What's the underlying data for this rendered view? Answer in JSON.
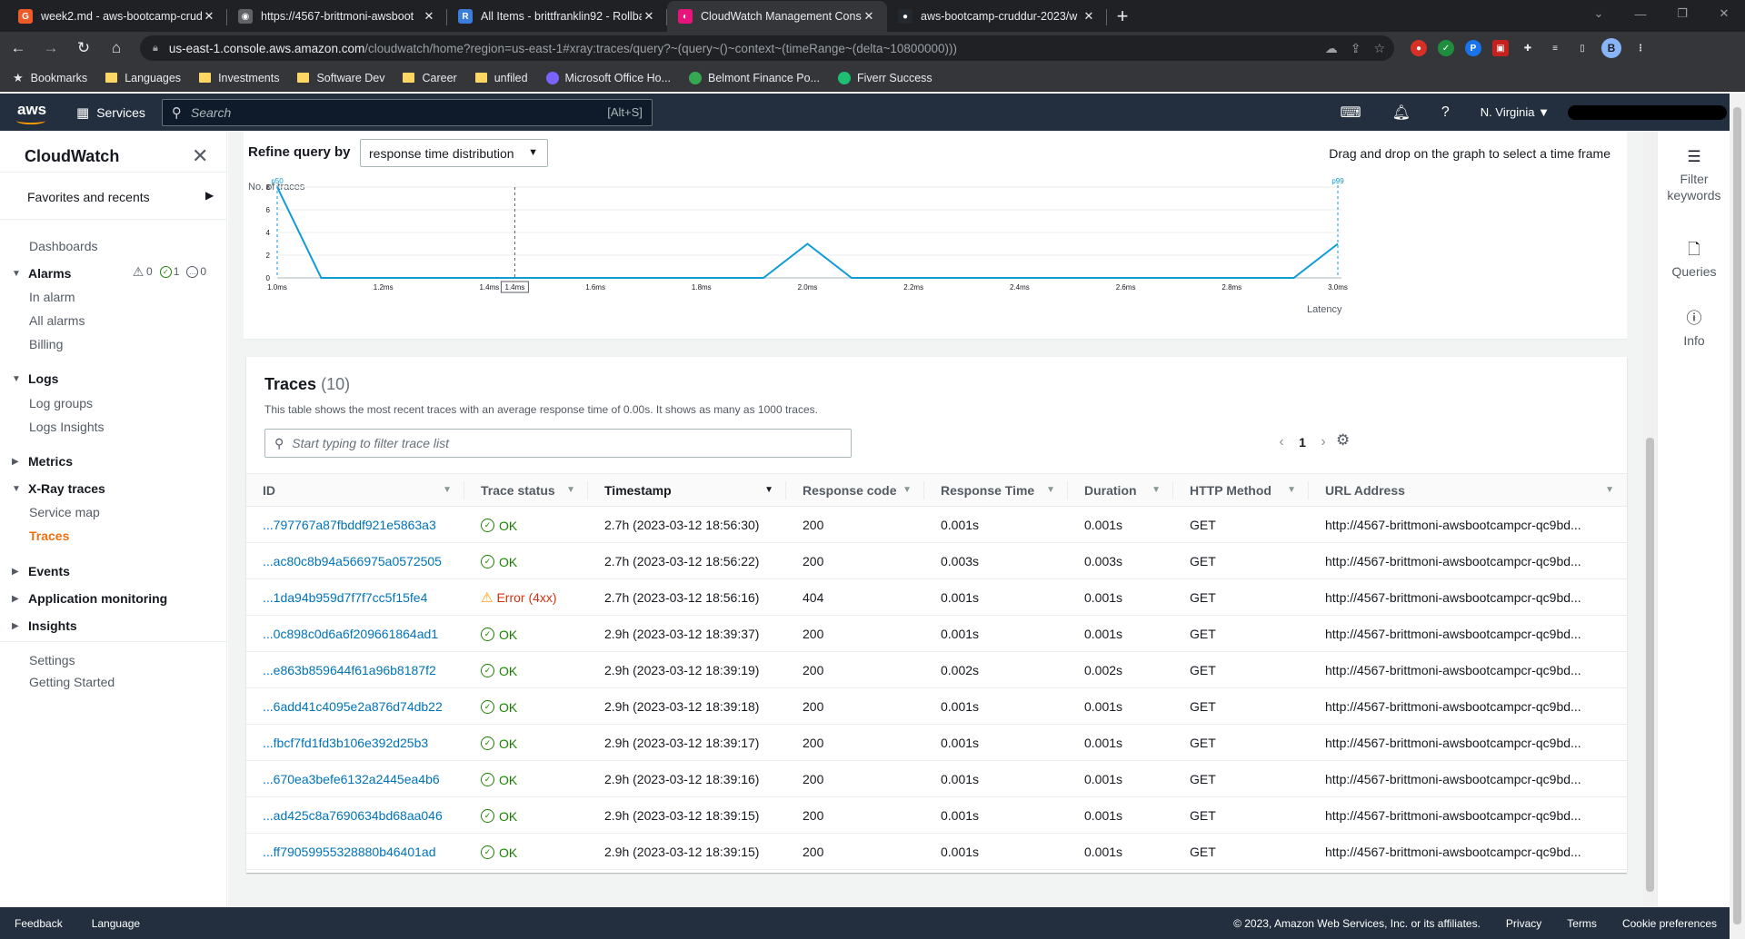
{
  "browser": {
    "tabs": [
      {
        "title": "week2.md - aws-bootcamp-crud",
        "favicon_color": "#f05a28",
        "favicon_char": "G",
        "active": false
      },
      {
        "title": "https://4567-brittmoni-awsboot",
        "favicon_color": "#5f6368",
        "favicon_char": "◉",
        "active": false
      },
      {
        "title": "All Items - brittfranklin92 - Rollba",
        "favicon_color": "#3b7dd8",
        "favicon_char": "R",
        "active": false
      },
      {
        "title": "CloudWatch Management Conso",
        "favicon_color": "#e7157b",
        "favicon_char": "◐",
        "active": true
      },
      {
        "title": "aws-bootcamp-cruddur-2023/w",
        "favicon_color": "#24292f",
        "favicon_char": "●",
        "active": false
      }
    ],
    "url_host": "us-east-1.console.aws.amazon.com",
    "url_path": "/cloudwatch/home?region=us-east-1#xray:traces/query?~(query~()~context~(timeRange~(delta~10800000)))",
    "profile_initial": "B",
    "bookmarks": [
      {
        "label": "Bookmarks",
        "kind": "star"
      },
      {
        "label": "Languages",
        "kind": "folder"
      },
      {
        "label": "Investments",
        "kind": "folder"
      },
      {
        "label": "Software Dev",
        "kind": "folder"
      },
      {
        "label": "Career",
        "kind": "folder"
      },
      {
        "label": "unfiled",
        "kind": "folder"
      },
      {
        "label": "Microsoft Office Ho...",
        "kind": "site",
        "color": "#7b61ff"
      },
      {
        "label": "Belmont Finance Po...",
        "kind": "site",
        "color": "#34a853"
      },
      {
        "label": "Fiverr Success",
        "kind": "site",
        "color": "#1dbf73"
      }
    ]
  },
  "aws": {
    "logo_text": "aws",
    "services_label": "Services",
    "search_placeholder": "Search",
    "search_shortcut": "[Alt+S]",
    "region": "N. Virginia ▼"
  },
  "sidebar": {
    "title": "CloudWatch",
    "favorites": "Favorites and recents",
    "dashboards": "Dashboards",
    "alarms": "Alarms",
    "alarm_counts": {
      "in_alarm": "0",
      "ok": "1",
      "insufficient": "0"
    },
    "in_alarm": "In alarm",
    "all_alarms": "All alarms",
    "billing": "Billing",
    "logs": "Logs",
    "log_groups": "Log groups",
    "logs_insights": "Logs Insights",
    "metrics": "Metrics",
    "xray": "X-Ray traces",
    "service_map": "Service map",
    "traces": "Traces",
    "events": "Events",
    "app_monitoring": "Application monitoring",
    "insights": "Insights",
    "settings": "Settings",
    "getting_started": "Getting Started"
  },
  "refine": {
    "label": "Refine query by",
    "selected": "response time distribution",
    "drag_hint": "Drag and drop on the graph to select a time frame"
  },
  "chart_data": {
    "type": "line",
    "ylabel": "No. of traces",
    "xlabel": "Latency",
    "x_ticks": [
      "1.0ms",
      "1.2ms",
      "1.4ms",
      "1.6ms",
      "1.8ms",
      "2.0ms",
      "2.2ms",
      "2.4ms",
      "2.6ms",
      "2.8ms",
      "3.0ms"
    ],
    "y_ticks": [
      0,
      2,
      4,
      6,
      8
    ],
    "xlim": [
      1.0,
      3.0
    ],
    "ylim": [
      0,
      8
    ],
    "x": [
      1.0,
      1.083,
      1.917,
      2.0,
      2.083,
      2.917,
      3.0
    ],
    "y": [
      8,
      0,
      0,
      3,
      0,
      0,
      3
    ],
    "markers": [
      {
        "label": "p50",
        "x": 1.0
      },
      {
        "label": "p99",
        "x": 3.0
      }
    ],
    "cursor_label": "1.4ms",
    "cursor_x": 1.448,
    "line_color": "#0f9bd7"
  },
  "traces": {
    "title": "Traces",
    "count": "(10)",
    "description": "This table shows the most recent traces with an average response time of 0.00s. It shows as many as 1000 traces.",
    "filter_placeholder": "Start typing to filter trace list",
    "page": "1",
    "columns": [
      "ID",
      "Trace status",
      "Timestamp",
      "Response code",
      "Response Time",
      "Duration",
      "HTTP Method",
      "URL Address"
    ],
    "rows": [
      {
        "id": "...797767a87fbddf921e5863a3",
        "status": "OK",
        "timestamp": "2.7h (2023-03-12 18:56:30)",
        "code": "200",
        "response_time": "0.001s",
        "duration": "0.001s",
        "method": "GET",
        "url": "http://4567-brittmoni-awsbootcampcr-qc9bd..."
      },
      {
        "id": "...ac80c8b94a566975a0572505",
        "status": "OK",
        "timestamp": "2.7h (2023-03-12 18:56:22)",
        "code": "200",
        "response_time": "0.003s",
        "duration": "0.003s",
        "method": "GET",
        "url": "http://4567-brittmoni-awsbootcampcr-qc9bd..."
      },
      {
        "id": "...1da94b959d7f7f7cc5f15fe4",
        "status": "Error (4xx)",
        "timestamp": "2.7h (2023-03-12 18:56:16)",
        "code": "404",
        "response_time": "0.001s",
        "duration": "0.001s",
        "method": "GET",
        "url": "http://4567-brittmoni-awsbootcampcr-qc9bd..."
      },
      {
        "id": "...0c898c0d6a6f209661864ad1",
        "status": "OK",
        "timestamp": "2.9h (2023-03-12 18:39:37)",
        "code": "200",
        "response_time": "0.001s",
        "duration": "0.001s",
        "method": "GET",
        "url": "http://4567-brittmoni-awsbootcampcr-qc9bd..."
      },
      {
        "id": "...e863b859644f61a96b8187f2",
        "status": "OK",
        "timestamp": "2.9h (2023-03-12 18:39:19)",
        "code": "200",
        "response_time": "0.002s",
        "duration": "0.002s",
        "method": "GET",
        "url": "http://4567-brittmoni-awsbootcampcr-qc9bd..."
      },
      {
        "id": "...6add41c4095e2a876d74db22",
        "status": "OK",
        "timestamp": "2.9h (2023-03-12 18:39:18)",
        "code": "200",
        "response_time": "0.001s",
        "duration": "0.001s",
        "method": "GET",
        "url": "http://4567-brittmoni-awsbootcampcr-qc9bd..."
      },
      {
        "id": "...fbcf7fd1fd3b106e392d25b3",
        "status": "OK",
        "timestamp": "2.9h (2023-03-12 18:39:17)",
        "code": "200",
        "response_time": "0.001s",
        "duration": "0.001s",
        "method": "GET",
        "url": "http://4567-brittmoni-awsbootcampcr-qc9bd..."
      },
      {
        "id": "...670ea3befe6132a2445ea4b6",
        "status": "OK",
        "timestamp": "2.9h (2023-03-12 18:39:16)",
        "code": "200",
        "response_time": "0.001s",
        "duration": "0.001s",
        "method": "GET",
        "url": "http://4567-brittmoni-awsbootcampcr-qc9bd..."
      },
      {
        "id": "...ad425c8a7690634bd68aa046",
        "status": "OK",
        "timestamp": "2.9h (2023-03-12 18:39:15)",
        "code": "200",
        "response_time": "0.001s",
        "duration": "0.001s",
        "method": "GET",
        "url": "http://4567-brittmoni-awsbootcampcr-qc9bd..."
      },
      {
        "id": "...ff79059955328880b46401ad",
        "status": "OK",
        "timestamp": "2.9h (2023-03-12 18:39:15)",
        "code": "200",
        "response_time": "0.001s",
        "duration": "0.001s",
        "method": "GET",
        "url": "http://4567-brittmoni-awsbootcampcr-qc9bd..."
      }
    ]
  },
  "tools": {
    "filter_keywords": "Filter keywords",
    "queries": "Queries",
    "info": "Info"
  },
  "footer": {
    "feedback": "Feedback",
    "language": "Language",
    "copyright": "© 2023, Amazon Web Services, Inc. or its affiliates.",
    "privacy": "Privacy",
    "terms": "Terms",
    "cookies": "Cookie preferences"
  }
}
